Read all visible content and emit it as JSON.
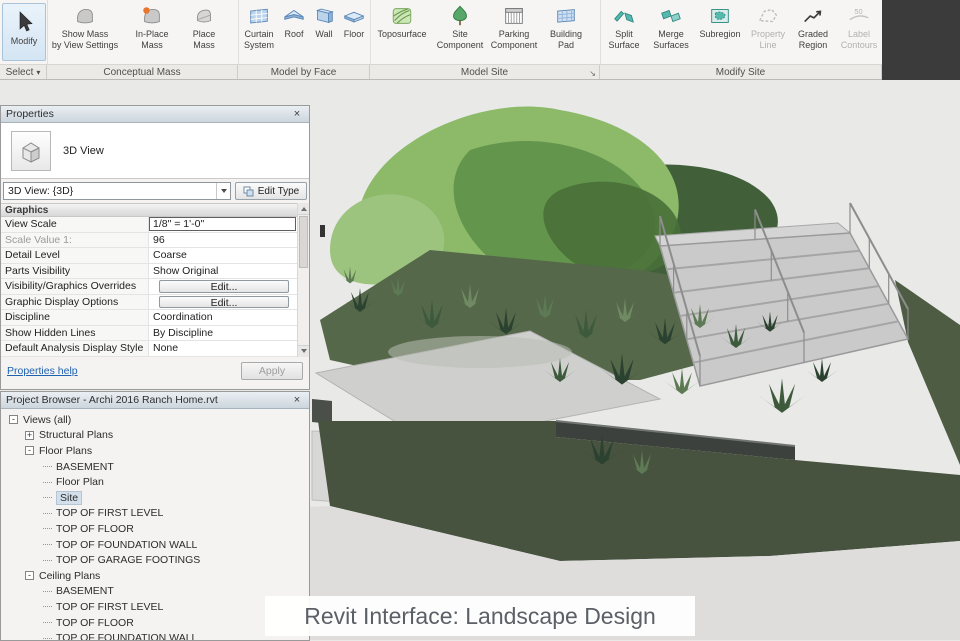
{
  "ribbon": {
    "modify_label": "Modify",
    "select_group_label": "Select",
    "groups": [
      "Conceptual Mass",
      "Model by Face",
      "Model Site",
      "Modify Site"
    ],
    "buttons": {
      "show_mass": {
        "line1": "Show Mass",
        "line2": "by View Settings"
      },
      "inplace_mass": {
        "line1": "In-Place",
        "line2": "Mass"
      },
      "place_mass": {
        "line1": "Place",
        "line2": "Mass"
      },
      "curtain_system": {
        "line1": "Curtain",
        "line2": "System"
      },
      "roof": {
        "line1": "Roof"
      },
      "wall": {
        "line1": "Wall"
      },
      "floor": {
        "line1": "Floor"
      },
      "toposurface": {
        "line1": "Toposurface"
      },
      "site_component": {
        "line1": "Site",
        "line2": "Component"
      },
      "parking_component": {
        "line1": "Parking",
        "line2": "Component"
      },
      "building_pad": {
        "line1": "Building",
        "line2": "Pad"
      },
      "split_surface": {
        "line1": "Split",
        "line2": "Surface"
      },
      "merge_surfaces": {
        "line1": "Merge",
        "line2": "Surfaces"
      },
      "subregion": {
        "line1": "Subregion"
      },
      "property_line": {
        "line1": "Property",
        "line2": "Line"
      },
      "graded_region": {
        "line1": "Graded",
        "line2": "Region"
      },
      "label_contours": {
        "line1": "Label",
        "line2": "Contours",
        "icon_text": "50"
      }
    }
  },
  "properties": {
    "title": "Properties",
    "type_name": "3D View",
    "selector_value": "3D View: {3D}",
    "edit_type_label": "Edit Type",
    "section": "Graphics",
    "rows": [
      {
        "label": "View Scale",
        "value": "1/8\" = 1'-0\""
      },
      {
        "label": "Scale Value    1:",
        "value": "96"
      },
      {
        "label": "Detail Level",
        "value": "Coarse"
      },
      {
        "label": "Parts Visibility",
        "value": "Show Original"
      },
      {
        "label": "Visibility/Graphics Overrides",
        "value": "Edit..."
      },
      {
        "label": "Graphic Display Options",
        "value": "Edit..."
      },
      {
        "label": "Discipline",
        "value": "Coordination"
      },
      {
        "label": "Show Hidden Lines",
        "value": "By Discipline"
      },
      {
        "label": "Default Analysis Display Style",
        "value": "None"
      }
    ],
    "help_link": "Properties help",
    "apply_label": "Apply"
  },
  "browser": {
    "title": "Project Browser - Archi 2016 Ranch Home.rvt",
    "items": [
      {
        "label": "Views (all)"
      },
      {
        "label": "Structural Plans"
      },
      {
        "label": "Floor Plans"
      },
      {
        "label": "BASEMENT"
      },
      {
        "label": "Floor Plan"
      },
      {
        "label": "Site"
      },
      {
        "label": "TOP OF FIRST LEVEL"
      },
      {
        "label": "TOP OF FLOOR"
      },
      {
        "label": "TOP OF FOUNDATION WALL"
      },
      {
        "label": "TOP OF GARAGE FOOTINGS"
      },
      {
        "label": "Ceiling Plans"
      },
      {
        "label": "BASEMENT"
      },
      {
        "label": "TOP OF FIRST LEVEL"
      },
      {
        "label": "TOP OF FLOOR"
      },
      {
        "label": "TOP OF FOUNDATION WALL"
      }
    ]
  },
  "icons": {
    "minus": "-",
    "plus": "+",
    "close": "×",
    "dropdown": "▾",
    "launcher": "↘"
  },
  "caption": "Revit Interface: Landscape Design",
  "colors": {
    "selection": "#d3dfea",
    "link": "#1f62b0",
    "ribbon_dark": "#3b3b3b"
  }
}
